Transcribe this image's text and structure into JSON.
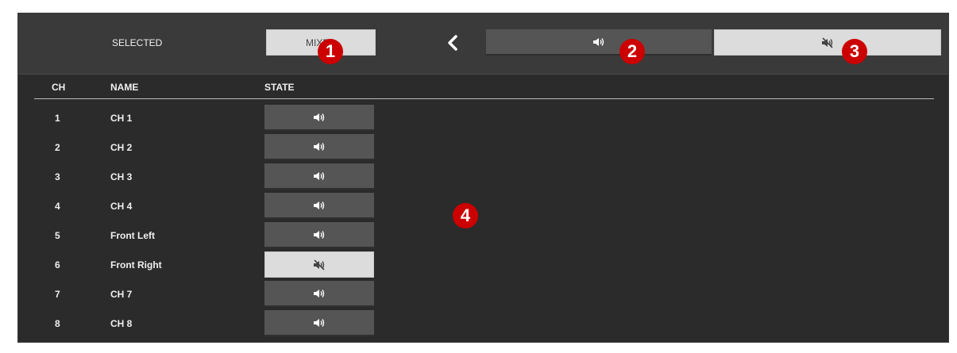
{
  "header": {
    "selected_label": "SELECTED",
    "mixed_label": "MIXED",
    "back_icon": "chevron-left-icon",
    "unmute_all_icon": "speaker-icon",
    "mute_all_icon": "speaker-muted-icon"
  },
  "badges": [
    "1",
    "2",
    "3",
    "4"
  ],
  "table": {
    "columns": [
      "CH",
      "NAME",
      "STATE"
    ],
    "rows": [
      {
        "ch": "1",
        "name": "CH 1",
        "state": "unmuted"
      },
      {
        "ch": "2",
        "name": "CH 2",
        "state": "unmuted"
      },
      {
        "ch": "3",
        "name": "CH 3",
        "state": "unmuted"
      },
      {
        "ch": "4",
        "name": "CH 4",
        "state": "unmuted"
      },
      {
        "ch": "5",
        "name": "Front Left",
        "state": "unmuted"
      },
      {
        "ch": "6",
        "name": "Front Right",
        "state": "muted"
      },
      {
        "ch": "7",
        "name": "CH 7",
        "state": "unmuted"
      },
      {
        "ch": "8",
        "name": "CH 8",
        "state": "unmuted"
      }
    ]
  },
  "colors": {
    "panel": "#2b2b2b",
    "header": "#3a3a3a",
    "button_dark": "#555555",
    "button_light": "#dcdcdc",
    "badge": "#cc0000"
  }
}
